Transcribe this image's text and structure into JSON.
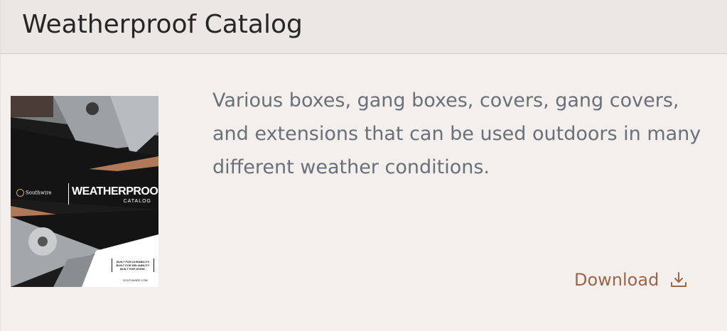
{
  "header": {
    "title": "Weatherproof Catalog"
  },
  "catalog": {
    "cover": {
      "brand": "Southwire",
      "title": "WEATHERPROOF",
      "subtitle": "CATALOG",
      "tagline": [
        "BUILT FOR DURABILITY",
        "BUILT FOR RELIABILITY",
        "BUILT FOR WORK."
      ],
      "url": "SOUTHWIRE.COM"
    },
    "description": "Various boxes, gang boxes, covers, gang covers, and extensions that can be used outdoors in many different weather conditions.",
    "download_label": "Download",
    "download_icon": "download-icon"
  },
  "colors": {
    "header_bg": "#ebe7e4",
    "card_bg": "#f3efec",
    "text": "#6b7078",
    "accent": "#9a6649"
  }
}
